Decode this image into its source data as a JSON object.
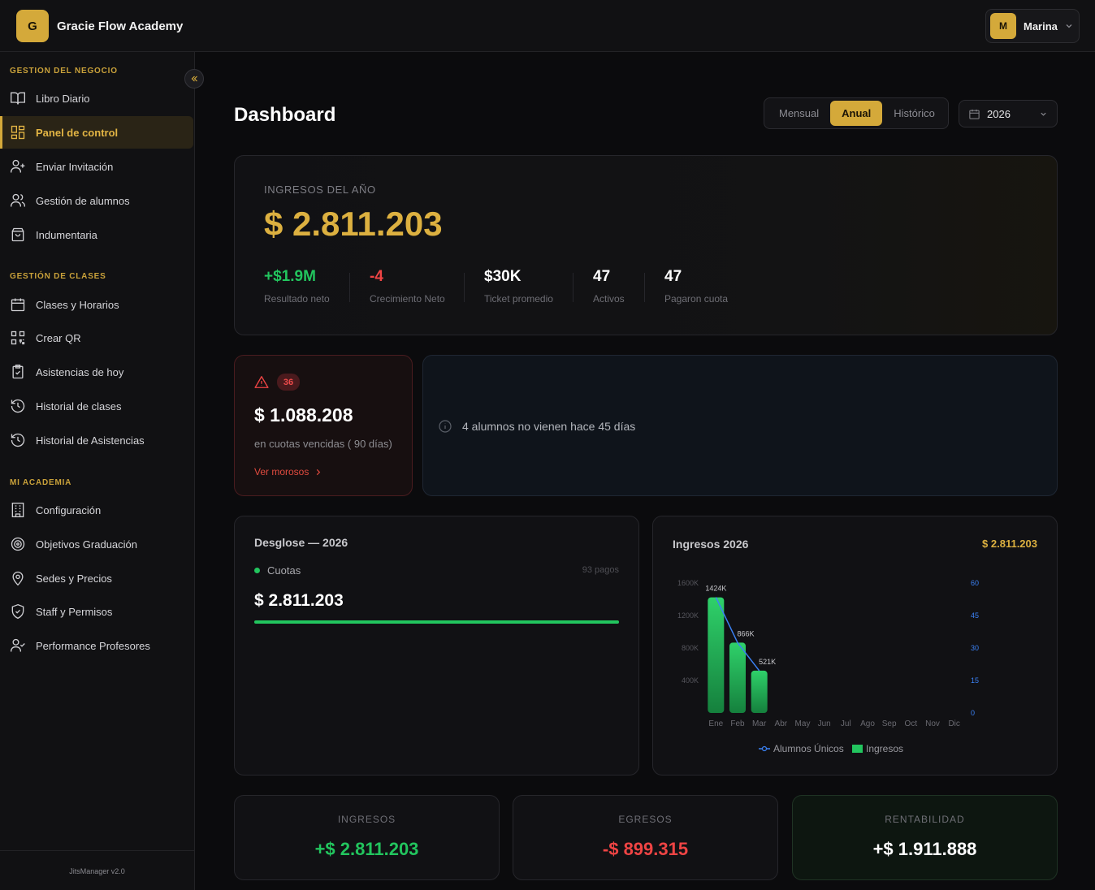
{
  "app": {
    "logo_letter": "G",
    "name": "Gracie Flow Academy",
    "version": "JitsManager v2.0"
  },
  "user": {
    "initial": "M",
    "name": "Marina"
  },
  "sidebar": {
    "sections": [
      {
        "title": "GESTION DEL NEGOCIO",
        "items": [
          {
            "label": "Libro Diario",
            "icon": "book-icon"
          },
          {
            "label": "Panel de control",
            "icon": "dashboard-icon",
            "active": true
          },
          {
            "label": "Enviar Invitación",
            "icon": "user-plus-icon"
          },
          {
            "label": "Gestión de alumnos",
            "icon": "users-icon"
          },
          {
            "label": "Indumentaria",
            "icon": "shopping-bag-icon"
          }
        ]
      },
      {
        "title": "GESTIÓN DE CLASES",
        "items": [
          {
            "label": "Clases y Horarios",
            "icon": "calendar-icon"
          },
          {
            "label": "Crear QR",
            "icon": "qr-code-icon"
          },
          {
            "label": "Asistencias de hoy",
            "icon": "clipboard-check-icon"
          },
          {
            "label": "Historial de clases",
            "icon": "history-icon"
          },
          {
            "label": "Historial de Asistencias",
            "icon": "history-icon"
          }
        ]
      },
      {
        "title": "MI ACADEMIA",
        "items": [
          {
            "label": "Configuración",
            "icon": "building-icon"
          },
          {
            "label": "Objetivos Graduación",
            "icon": "target-icon"
          },
          {
            "label": "Sedes y Precios",
            "icon": "map-pin-icon"
          },
          {
            "label": "Staff y Permisos",
            "icon": "shield-check-icon"
          },
          {
            "label": "Performance Profesores",
            "icon": "user-check-icon"
          }
        ]
      }
    ]
  },
  "header": {
    "title": "Dashboard",
    "period_tabs": [
      "Mensual",
      "Anual",
      "Histórico"
    ],
    "active_period": "Anual",
    "year": "2026"
  },
  "hero": {
    "label": "INGRESOS DEL AÑO",
    "amount": "$ 2.811.203",
    "stats": [
      {
        "value": "+$1.9M",
        "label": "Resultado neto",
        "color": "#22c55e"
      },
      {
        "value": "-4",
        "label": "Crecimiento Neto",
        "color": "#ef4444"
      },
      {
        "value": "$30K",
        "label": "Ticket promedio",
        "color": "#ffffff"
      },
      {
        "value": "47",
        "label": "Activos",
        "color": "#ffffff"
      },
      {
        "value": "47",
        "label": "Pagaron cuota",
        "color": "#ffffff"
      }
    ]
  },
  "overdue": {
    "count": "36",
    "amount": "$ 1.088.208",
    "subtitle": "en cuotas vencidas ( 90 días)",
    "link": "Ver morosos"
  },
  "info": {
    "text": "4 alumnos no vienen hace 45 días"
  },
  "breakdown": {
    "title": "Desglose — 2026",
    "item_label": "Cuotas",
    "item_count": "93 pagos",
    "item_amount": "$ 2.811.203",
    "share": 1.0
  },
  "chart_data": {
    "type": "bar",
    "title": "Ingresos 2026",
    "total": "$ 2.811.203",
    "categories": [
      "Ene",
      "Feb",
      "Mar",
      "Abr",
      "May",
      "Jun",
      "Jul",
      "Ago",
      "Sep",
      "Oct",
      "Nov",
      "Dic"
    ],
    "series": [
      {
        "name": "Ingresos",
        "type": "bar",
        "axis": "left",
        "values": [
          1424,
          866,
          521,
          0,
          0,
          0,
          0,
          0,
          0,
          0,
          0,
          0
        ],
        "labels": [
          "1424K",
          "866K",
          "521K"
        ]
      },
      {
        "name": "Alumnos Únicos",
        "type": "line",
        "axis": "right",
        "values": [
          null,
          null,
          null,
          null,
          null,
          null,
          null,
          null,
          null,
          null,
          null,
          null
        ]
      }
    ],
    "y_left_ticks": [
      "400K",
      "800K",
      "1200K",
      "1600K"
    ],
    "y_left_range": [
      0,
      1600
    ],
    "y_right_ticks": [
      "0",
      "15",
      "30",
      "45",
      "60"
    ],
    "y_right_range": [
      0,
      60
    ],
    "legend": [
      "Alumnos Únicos",
      "Ingresos"
    ],
    "colors": {
      "bar": "#22c55e",
      "line": "#3b82f6"
    }
  },
  "summary": [
    {
      "label": "INGRESOS",
      "value": "+$ 2.811.203",
      "color": "#22c55e"
    },
    {
      "label": "EGRESOS",
      "value": "-$ 899.315",
      "color": "#ef4444"
    },
    {
      "label": "RENTABILIDAD",
      "value": "+$ 1.911.888",
      "color": "#ffffff"
    }
  ]
}
